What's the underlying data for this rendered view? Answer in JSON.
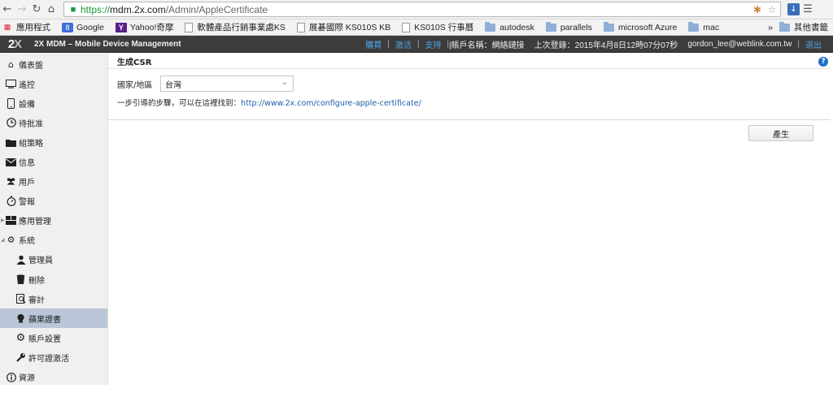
{
  "browser": {
    "back_icon": "back-arrow-icon",
    "forward_icon": "forward-arrow-icon",
    "url_scheme": "https://",
    "url_host": "mdm.2x.com",
    "url_path": "/Admin/AppleCertificate",
    "bookmarks": [
      {
        "label": "應用程式",
        "icon": "apps-grid-icon"
      },
      {
        "label": "Google",
        "icon": "google-icon"
      },
      {
        "label": "Yahoo!奇摩",
        "icon": "yahoo-icon"
      },
      {
        "label": "軟體產品行銷事業處KS",
        "icon": "page-icon"
      },
      {
        "label": "展碁國際 KS010S KB",
        "icon": "page-icon"
      },
      {
        "label": "KS010S 行事曆",
        "icon": "page-icon"
      },
      {
        "label": "autodesk",
        "icon": "folder-icon"
      },
      {
        "label": "parallels",
        "icon": "folder-icon"
      },
      {
        "label": "microsoft Azure",
        "icon": "folder-icon"
      },
      {
        "label": "mac",
        "icon": "folder-icon"
      }
    ],
    "more_bookmarks": "»",
    "other_bookmarks": "其他書籤"
  },
  "header": {
    "logo_main": "2",
    "logo_x": "X",
    "title": "2X MDM – Mobile Device Management",
    "buy": "購買",
    "activate": "激活",
    "support": "支持",
    "account": "|賬戶名稱：網絡鏈接",
    "last_login": "上次登錄：2015年4月8日12時07分07秒",
    "user": "gordon_lee@weblink.com.tw",
    "logout": "退出",
    "sep": "|"
  },
  "sidebar": {
    "items": [
      {
        "label": "儀表盤",
        "icon": "home-icon"
      },
      {
        "label": "遙控",
        "icon": "monitor-icon"
      },
      {
        "label": "設備",
        "icon": "phone-icon"
      },
      {
        "label": "待批准",
        "icon": "clock-icon"
      },
      {
        "label": "組策略",
        "icon": "folder-icon"
      },
      {
        "label": "信息",
        "icon": "envelope-icon"
      },
      {
        "label": "用戶",
        "icon": "users-icon"
      },
      {
        "label": "警報",
        "icon": "stopwatch-icon"
      },
      {
        "label": "應用管理",
        "icon": "apps-icon"
      },
      {
        "label": "系統",
        "icon": "gears-icon"
      },
      {
        "label": "管理員",
        "icon": "admin-icon"
      },
      {
        "label": "刪除",
        "icon": "trash-icon"
      },
      {
        "label": "審計",
        "icon": "audit-icon"
      },
      {
        "label": "蘋果證書",
        "icon": "apple-icon"
      },
      {
        "label": "賬戶設置",
        "icon": "gear-icon"
      },
      {
        "label": "許可證激活",
        "icon": "wrench-icon"
      },
      {
        "label": "資源",
        "icon": "info-icon"
      }
    ]
  },
  "main": {
    "panel_title": "生成CSR",
    "country_label": "國家/地區",
    "country_value": "台灣",
    "info_text": "一步引導的步驟，可以在這裡找到：",
    "info_link": "http://www.2x.com/configure-apple-certificate/",
    "generate_button": "產生"
  }
}
